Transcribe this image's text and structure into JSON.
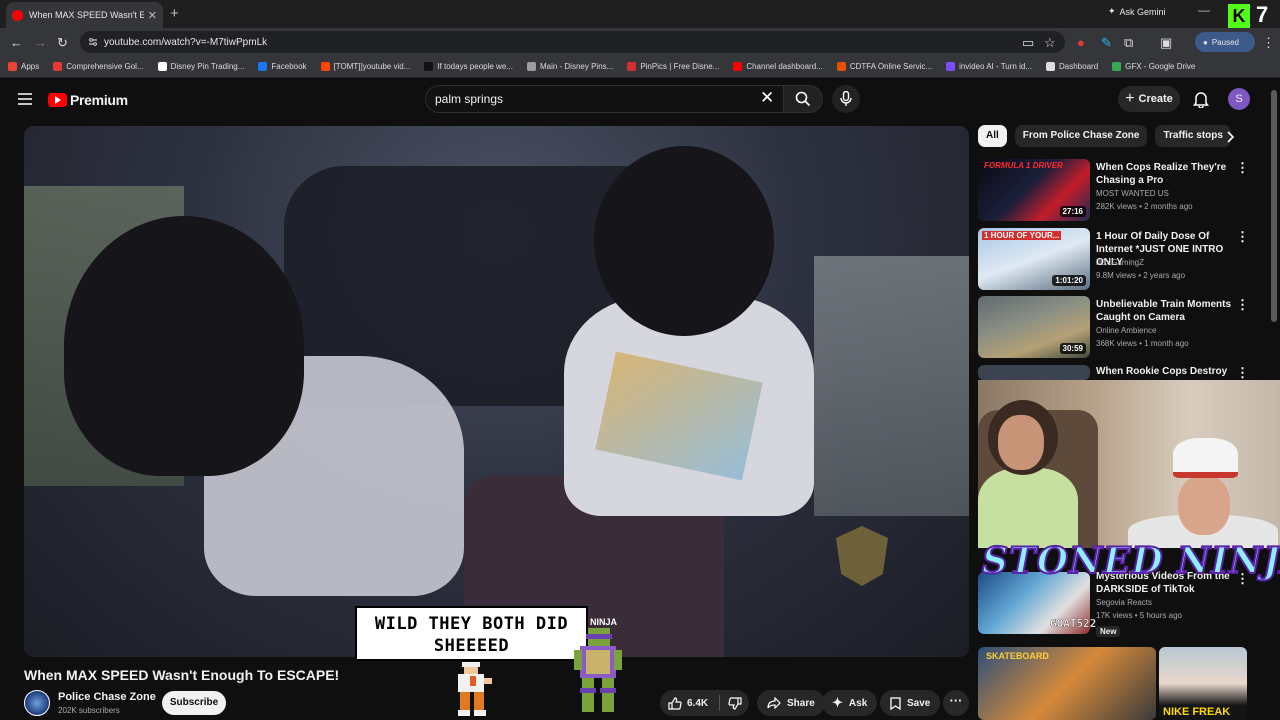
{
  "browser": {
    "tab_title": "When MAX SPEED Wasn't Enou",
    "url": "youtube.com/watch?v=-M7tiwPpmLk",
    "ask_gemini": "Ask Gemini",
    "profile_status": "Paused",
    "kick_number": "7",
    "bookmarks": [
      {
        "label": "Apps",
        "color": "#ea4335"
      },
      {
        "label": "Comprehensive Gol...",
        "color": "#e53935"
      },
      {
        "label": "Disney Pin Trading...",
        "color": "#ffffff"
      },
      {
        "label": "Facebook",
        "color": "#1877f2"
      },
      {
        "label": "[TOMT]]youtube vid...",
        "color": "#ff4500"
      },
      {
        "label": "If todays people we...",
        "color": "#111111"
      },
      {
        "label": "Main - Disney Pins...",
        "color": "#9e9e9e"
      },
      {
        "label": "PinPics | Free Disne...",
        "color": "#d32f2f"
      },
      {
        "label": "Channel dashboard...",
        "color": "#ff0000"
      },
      {
        "label": "CDTFA Online Servic...",
        "color": "#e65100"
      },
      {
        "label": "invideo AI - Turn id...",
        "color": "#7c4dff"
      },
      {
        "label": "Dashboard",
        "color": "#dddddd"
      },
      {
        "label": "GFX - Google Drive",
        "color": "#34a853"
      }
    ]
  },
  "youtube": {
    "logo_text": "Premium",
    "search_query": "palm springs",
    "create_label": "Create",
    "avatar_letter": "S"
  },
  "video": {
    "title": "When MAX SPEED Wasn't Enough To ESCAPE!",
    "channel": "Police Chase Zone",
    "subscribers": "202K subscribers",
    "subscribe_label": "Subscribe",
    "likes": "6.4K",
    "share_label": "Share",
    "ask_label": "Ask",
    "save_label": "Save"
  },
  "stream_overlay": {
    "caption_line1": "WILD THEY BOTH DID",
    "caption_line2": "SHEEEED",
    "ninja_tag": "NINJA",
    "stoned_ninja": "STONED NINJA",
    "goat_tag": "GOAT522"
  },
  "chips": [
    "All",
    "From Police Chase Zone",
    "Traffic stops"
  ],
  "recommendations": [
    {
      "title": "When Cops Realize They're Chasing a Pro",
      "channel": "MOST WANTED US",
      "meta": "282K views • 2 months ago",
      "duration": "27:16",
      "thumb_text": "FORMULA 1 DRIVER"
    },
    {
      "title": "1 Hour Of Daily Dose Of Internet *JUST ONE INTRO ONLY",
      "channel": "JDXGamingZ",
      "meta": "9.8M views • 2 years ago",
      "duration": "1:01:20",
      "thumb_text": "1 HOUR OF YOUR..."
    },
    {
      "title": "Unbelievable Train Moments Caught on Camera",
      "channel": "Online Ambience",
      "meta": "368K views • 1 month ago",
      "duration": "30:59",
      "thumb_text": ""
    },
    {
      "title": "When Rookie Cops Destroy",
      "channel": "",
      "meta": "",
      "duration": "",
      "thumb_text": ""
    },
    {
      "title": "Mysterious Videos From the DARKSIDE of TikTok",
      "channel": "Segovia Reacts",
      "meta": "17K views • 5 hours ago",
      "duration": "",
      "thumb_text": "",
      "badge": "New"
    }
  ],
  "bottom_thumbs": {
    "left_text": "SKATEBOARD",
    "right_text": "NIKE FREAK"
  }
}
